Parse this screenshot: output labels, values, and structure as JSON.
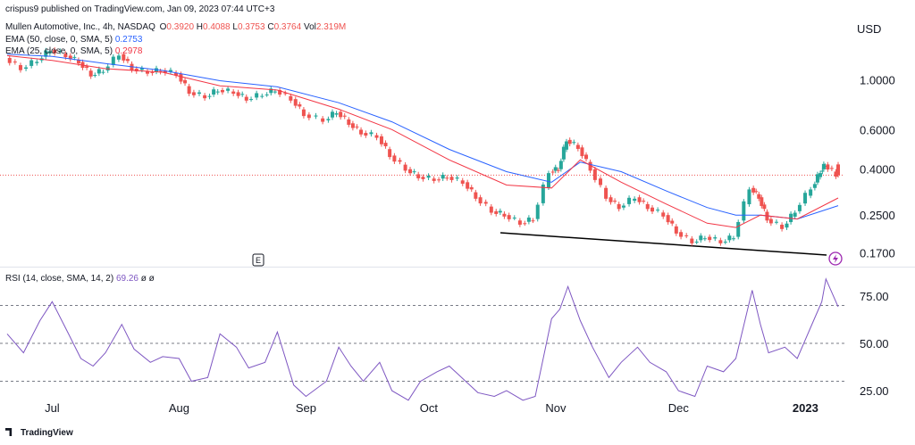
{
  "publisher_line": "crispus9 published on TradingView.com, Jan 09, 2023 07:44 UTC+3",
  "legend": {
    "symbol": "Mullen Automotive, Inc., 4h, NASDAQ",
    "ohlc": [
      {
        "k": "O",
        "v": "0.3920"
      },
      {
        "k": "H",
        "v": "0.4088"
      },
      {
        "k": "L",
        "v": "0.3753"
      },
      {
        "k": "C",
        "v": "0.3764"
      },
      {
        "k": "Vol",
        "v": "2.319M"
      }
    ],
    "ema50_label": "EMA (50, close, 0, SMA, 5)",
    "ema50_value": "0.2753",
    "ema25_label": "EMA (25, close, 0, SMA, 5)",
    "ema25_value": "0.2978",
    "rsi_label": "RSI (14, close, SMA, 14, 2)",
    "rsi_value": "69.26",
    "rsi_extra": "ø  ø"
  },
  "currency": "USD",
  "earnings_marker": "E",
  "brand": "TradingView",
  "colors": {
    "up": "#26a69a",
    "down": "#ef5350",
    "ema50": "#2962ff",
    "ema25": "#f23645",
    "rsi": "#7e57c2",
    "trendline": "#000000"
  },
  "chart_data": [
    {
      "type": "candlestick",
      "title": "Mullen Automotive, Inc., 4h, NASDAQ",
      "y_scale": "log",
      "y_ticks": [
        "1.0000",
        "0.6000",
        "0.4000",
        "0.2500",
        "0.1700"
      ],
      "x_ticks": [
        "Jul",
        "Aug",
        "Sep",
        "Oct",
        "Nov",
        "Dec",
        "2023"
      ],
      "last_price": 0.3764,
      "series": [
        {
          "name": "MULN close (approx.)",
          "points": [
            [
              "Jun 20",
              1.25
            ],
            [
              "Jun 24",
              1.12
            ],
            [
              "Jun 28",
              1.22
            ],
            [
              "Jul 1",
              1.36
            ],
            [
              "Jul 5",
              1.28
            ],
            [
              "Jul 8",
              1.2
            ],
            [
              "Jul 11",
              1.05
            ],
            [
              "Jul 14",
              1.1
            ],
            [
              "Jul 18",
              1.3
            ],
            [
              "Jul 21",
              1.12
            ],
            [
              "Jul 25",
              1.08
            ],
            [
              "Jul 28",
              1.1
            ],
            [
              "Aug 1",
              1.06
            ],
            [
              "Aug 4",
              0.88
            ],
            [
              "Aug 8",
              0.84
            ],
            [
              "Aug 11",
              0.9
            ],
            [
              "Aug 15",
              0.88
            ],
            [
              "Aug 18",
              0.82
            ],
            [
              "Aug 22",
              0.86
            ],
            [
              "Aug 25",
              0.9
            ],
            [
              "Aug 29",
              0.82
            ],
            [
              "Sep 1",
              0.7
            ],
            [
              "Sep 6",
              0.66
            ],
            [
              "Sep 9",
              0.72
            ],
            [
              "Sep 12",
              0.64
            ],
            [
              "Sep 15",
              0.58
            ],
            [
              "Sep 19",
              0.56
            ],
            [
              "Sep 22",
              0.46
            ],
            [
              "Sep 26",
              0.4
            ],
            [
              "Sep 29",
              0.37
            ],
            [
              "Oct 3",
              0.36
            ],
            [
              "Oct 6",
              0.37
            ],
            [
              "Oct 10",
              0.35
            ],
            [
              "Oct 13",
              0.3
            ],
            [
              "Oct 17",
              0.26
            ],
            [
              "Oct 20",
              0.25
            ],
            [
              "Oct 24",
              0.23
            ],
            [
              "Oct 27",
              0.24
            ],
            [
              "Oct 31",
              0.39
            ],
            [
              "Nov 2",
              0.4
            ],
            [
              "Nov 4",
              0.54
            ],
            [
              "Nov 7",
              0.5
            ],
            [
              "Nov 10",
              0.4
            ],
            [
              "Nov 14",
              0.3
            ],
            [
              "Nov 17",
              0.27
            ],
            [
              "Nov 21",
              0.3
            ],
            [
              "Nov 24",
              0.27
            ],
            [
              "Nov 28",
              0.25
            ],
            [
              "Dec 1",
              0.21
            ],
            [
              "Dec 5",
              0.19
            ],
            [
              "Dec 8",
              0.2
            ],
            [
              "Dec 12",
              0.19
            ],
            [
              "Dec 15",
              0.2
            ],
            [
              "Dec 19",
              0.33
            ],
            [
              "Dec 21",
              0.3
            ],
            [
              "Dec 23",
              0.24
            ],
            [
              "Dec 27",
              0.22
            ],
            [
              "Dec 30",
              0.26
            ],
            [
              "Jan 3",
              0.33
            ],
            [
              "Jan 5",
              0.39
            ],
            [
              "Jan 6",
              0.42
            ],
            [
              "Jan 9",
              0.3764
            ]
          ]
        },
        {
          "name": "EMA (50, close, 0, SMA, 5)",
          "points": [
            [
              "Jun 20",
              1.3
            ],
            [
              "Jul 1",
              1.27
            ],
            [
              "Jul 14",
              1.18
            ],
            [
              "Jul 28",
              1.1
            ],
            [
              "Aug 11",
              0.99
            ],
            [
              "Aug 25",
              0.93
            ],
            [
              "Sep 9",
              0.79
            ],
            [
              "Sep 22",
              0.65
            ],
            [
              "Oct 6",
              0.49
            ],
            [
              "Oct 20",
              0.39
            ],
            [
              "Oct 31",
              0.35
            ],
            [
              "Nov 7",
              0.43
            ],
            [
              "Nov 17",
              0.39
            ],
            [
              "Nov 28",
              0.32
            ],
            [
              "Dec 8",
              0.27
            ],
            [
              "Dec 15",
              0.25
            ],
            [
              "Dec 21",
              0.25
            ],
            [
              "Dec 30",
              0.24
            ],
            [
              "Jan 9",
              0.2753
            ]
          ]
        },
        {
          "name": "EMA (25, close, 0, SMA, 5)",
          "points": [
            [
              "Jun 20",
              1.28
            ],
            [
              "Jul 1",
              1.22
            ],
            [
              "Jul 14",
              1.12
            ],
            [
              "Jul 28",
              1.08
            ],
            [
              "Aug 11",
              0.94
            ],
            [
              "Aug 25",
              0.9
            ],
            [
              "Sep 9",
              0.74
            ],
            [
              "Sep 22",
              0.6
            ],
            [
              "Oct 6",
              0.44
            ],
            [
              "Oct 20",
              0.34
            ],
            [
              "Oct 31",
              0.33
            ],
            [
              "Nov 7",
              0.44
            ],
            [
              "Nov 17",
              0.35
            ],
            [
              "Nov 28",
              0.28
            ],
            [
              "Dec 8",
              0.23
            ],
            [
              "Dec 15",
              0.22
            ],
            [
              "Dec 21",
              0.25
            ],
            [
              "Dec 30",
              0.24
            ],
            [
              "Jan 9",
              0.2978
            ]
          ]
        }
      ]
    },
    {
      "type": "line",
      "title": "RSI (14, close, SMA, 14, 2)",
      "y_ticks": [
        "75.00",
        "50.00",
        "25.00"
      ],
      "ylim": [
        10,
        90
      ],
      "reference_lines": [
        70,
        50,
        30
      ],
      "x_ticks": [
        "Jul",
        "Aug",
        "Sep",
        "Oct",
        "Nov",
        "Dec",
        "2023"
      ],
      "series": [
        {
          "name": "RSI (14, close, SMA, 14, 2)",
          "points": [
            [
              "Jun 20",
              55
            ],
            [
              "Jun 24",
              45
            ],
            [
              "Jun 28",
              62
            ],
            [
              "Jul 1",
              72
            ],
            [
              "Jul 5",
              55
            ],
            [
              "Jul 8",
              42
            ],
            [
              "Jul 11",
              38
            ],
            [
              "Jul 14",
              45
            ],
            [
              "Jul 18",
              60
            ],
            [
              "Jul 21",
              47
            ],
            [
              "Jul 25",
              40
            ],
            [
              "Jul 28",
              43
            ],
            [
              "Aug 1",
              42
            ],
            [
              "Aug 4",
              30
            ],
            [
              "Aug 8",
              32
            ],
            [
              "Aug 11",
              55
            ],
            [
              "Aug 15",
              48
            ],
            [
              "Aug 18",
              37
            ],
            [
              "Aug 22",
              40
            ],
            [
              "Aug 25",
              56
            ],
            [
              "Aug 29",
              28
            ],
            [
              "Sep 1",
              22
            ],
            [
              "Sep 6",
              30
            ],
            [
              "Sep 9",
              48
            ],
            [
              "Sep 12",
              38
            ],
            [
              "Sep 15",
              30
            ],
            [
              "Sep 19",
              40
            ],
            [
              "Sep 22",
              25
            ],
            [
              "Sep 26",
              20
            ],
            [
              "Sep 29",
              30
            ],
            [
              "Oct 3",
              35
            ],
            [
              "Oct 6",
              38
            ],
            [
              "Oct 10",
              30
            ],
            [
              "Oct 13",
              24
            ],
            [
              "Oct 17",
              22
            ],
            [
              "Oct 20",
              25
            ],
            [
              "Oct 24",
              20
            ],
            [
              "Oct 27",
              22
            ],
            [
              "Oct 31",
              63
            ],
            [
              "Nov 2",
              68
            ],
            [
              "Nov 4",
              80
            ],
            [
              "Nov 7",
              62
            ],
            [
              "Nov 10",
              48
            ],
            [
              "Nov 14",
              32
            ],
            [
              "Nov 17",
              40
            ],
            [
              "Nov 21",
              48
            ],
            [
              "Nov 24",
              40
            ],
            [
              "Nov 28",
              35
            ],
            [
              "Dec 1",
              25
            ],
            [
              "Dec 5",
              22
            ],
            [
              "Dec 8",
              38
            ],
            [
              "Dec 12",
              35
            ],
            [
              "Dec 15",
              42
            ],
            [
              "Dec 19",
              78
            ],
            [
              "Dec 21",
              60
            ],
            [
              "Dec 23",
              45
            ],
            [
              "Dec 27",
              48
            ],
            [
              "Dec 30",
              42
            ],
            [
              "Jan 3",
              62
            ],
            [
              "Jan 5",
              72
            ],
            [
              "Jan 6",
              84
            ],
            [
              "Jan 9",
              69.26
            ]
          ]
        }
      ]
    }
  ]
}
